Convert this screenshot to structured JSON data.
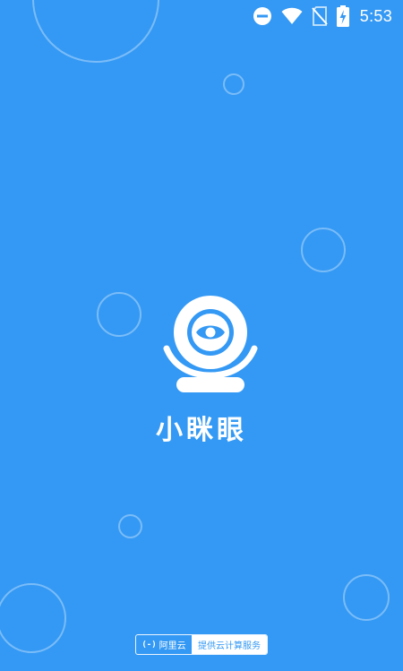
{
  "status_bar": {
    "time": "5:53",
    "icons": [
      "do-not-disturb-icon",
      "wifi-icon",
      "no-sim-icon",
      "battery-charging-icon"
    ]
  },
  "splash": {
    "app_name": "小眯眼",
    "logo_icon": "eye-camera-icon",
    "background_color": "#3499F4",
    "foreground_color": "#FFFFFF"
  },
  "footer": {
    "provider_brand": "阿里云",
    "provider_mark": "(-)",
    "provider_text": "提供云计算服务"
  }
}
